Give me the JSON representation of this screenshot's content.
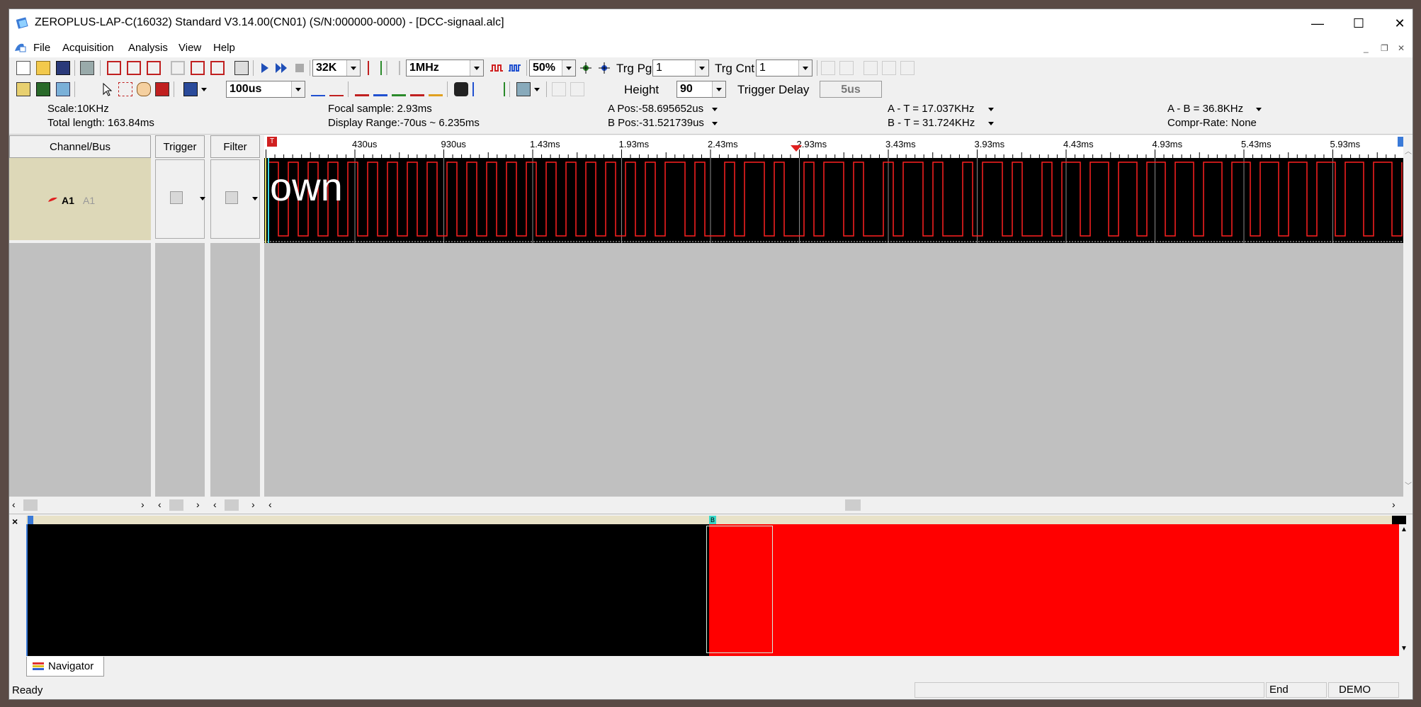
{
  "window": {
    "title": "ZEROPLUS-LAP-C(16032) Standard V3.14.00(CN01) (S/N:000000-0000) - [DCC-signaal.alc]",
    "minimize": "—",
    "maximize": "☐",
    "close": "✕"
  },
  "menu": {
    "items": [
      "File",
      "Acquisition",
      "Analysis",
      "View",
      "Help"
    ]
  },
  "toolbar1": {
    "memory_depth": "32K",
    "sample_rate": "1MHz",
    "trigger_level": "50%",
    "trg_pg_label": "Trg Pg",
    "trg_pg_value": "1",
    "trg_cnt_label": "Trg Cnt",
    "trg_cnt_value": "1"
  },
  "toolbar2": {
    "time_div": "100us",
    "height_label": "Height",
    "height_value": "90",
    "trigger_delay_label": "Trigger Delay",
    "trigger_delay_value": "5us"
  },
  "info": {
    "scale": "Scale:10KHz",
    "total_length": "Total length: 163.84ms",
    "focal_sample": "Focal sample: 2.93ms",
    "display_range": "Display Range:-70us ~ 6.235ms",
    "a_pos": "A Pos:-58.695652us",
    "b_pos": "B Pos:-31.521739us",
    "a_t": "A - T = 17.037KHz",
    "b_t": "B - T = 31.724KHz",
    "a_b": "A - B = 36.8KHz",
    "compr_rate": "Compr-Rate: None"
  },
  "columns": {
    "channel_bus": "Channel/Bus",
    "trigger": "Trigger",
    "filter": "Filter"
  },
  "channel": {
    "name": "A1",
    "alias": "A1"
  },
  "ruler": {
    "marker_t": "T",
    "ticks": [
      "430us",
      "930us",
      "1.43ms",
      "1.93ms",
      "2.43ms",
      "2.93ms",
      "3.43ms",
      "3.93ms",
      "4.43ms",
      "4.93ms",
      "5.43ms",
      "5.93ms"
    ]
  },
  "waveform": {
    "overlay_text": "own",
    "color": "#ff2020"
  },
  "navigator": {
    "tab_label": "Navigator",
    "marker_b": "B",
    "close": "×"
  },
  "status": {
    "text": "Ready",
    "end": "End",
    "demo": "DEMO"
  }
}
